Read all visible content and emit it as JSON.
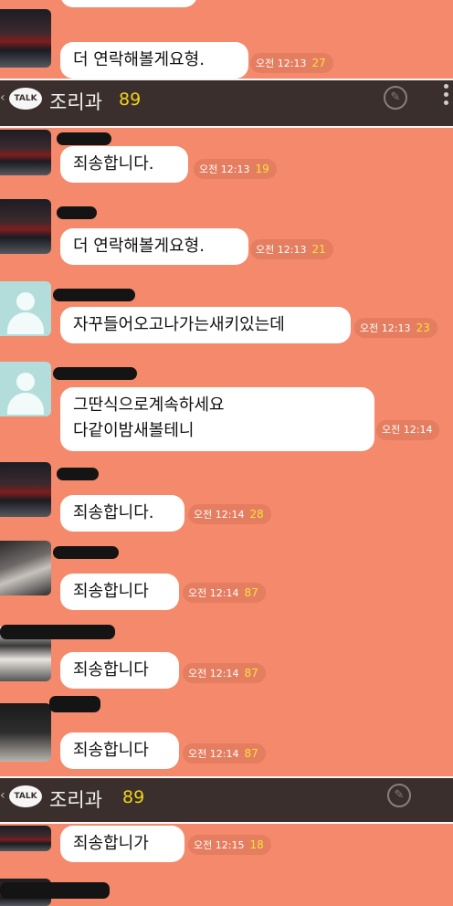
{
  "room": {
    "title": "조리과",
    "member_count": "89",
    "talk_badge": "TALK"
  },
  "messages": [
    {
      "text": "더 연락해볼게요형.",
      "time": "오전 12:13",
      "unread": "27"
    },
    {
      "text": "죄송합니다.",
      "time": "오전 12:13",
      "unread": "19"
    },
    {
      "text": "더 연락해볼게요형.",
      "time": "오전 12:13",
      "unread": "21"
    },
    {
      "text": "자꾸들어오고나가는새키있는데",
      "time": "오전 12:13",
      "unread": "23"
    },
    {
      "line1": "그딴식으로계속하세요",
      "line2": "다같이밤새볼테니",
      "time": "오전 12:14"
    },
    {
      "text": "죄송합니다.",
      "time": "오전 12:14",
      "unread": "28"
    },
    {
      "text": "죄송합니다",
      "time": "오전 12:14",
      "unread": "87"
    },
    {
      "text": "죄송합니다",
      "time": "오전 12:14",
      "unread": "87"
    },
    {
      "text": "죄송합니다",
      "time": "오전 12:14",
      "unread": "87"
    },
    {
      "text": "죄송합니가",
      "time": "오전 12:15",
      "unread": "18"
    }
  ],
  "colors": {
    "background": "#f4896b",
    "header": "#3a2f2c",
    "count": "#f2d21a",
    "unread": "#f7e23a"
  }
}
